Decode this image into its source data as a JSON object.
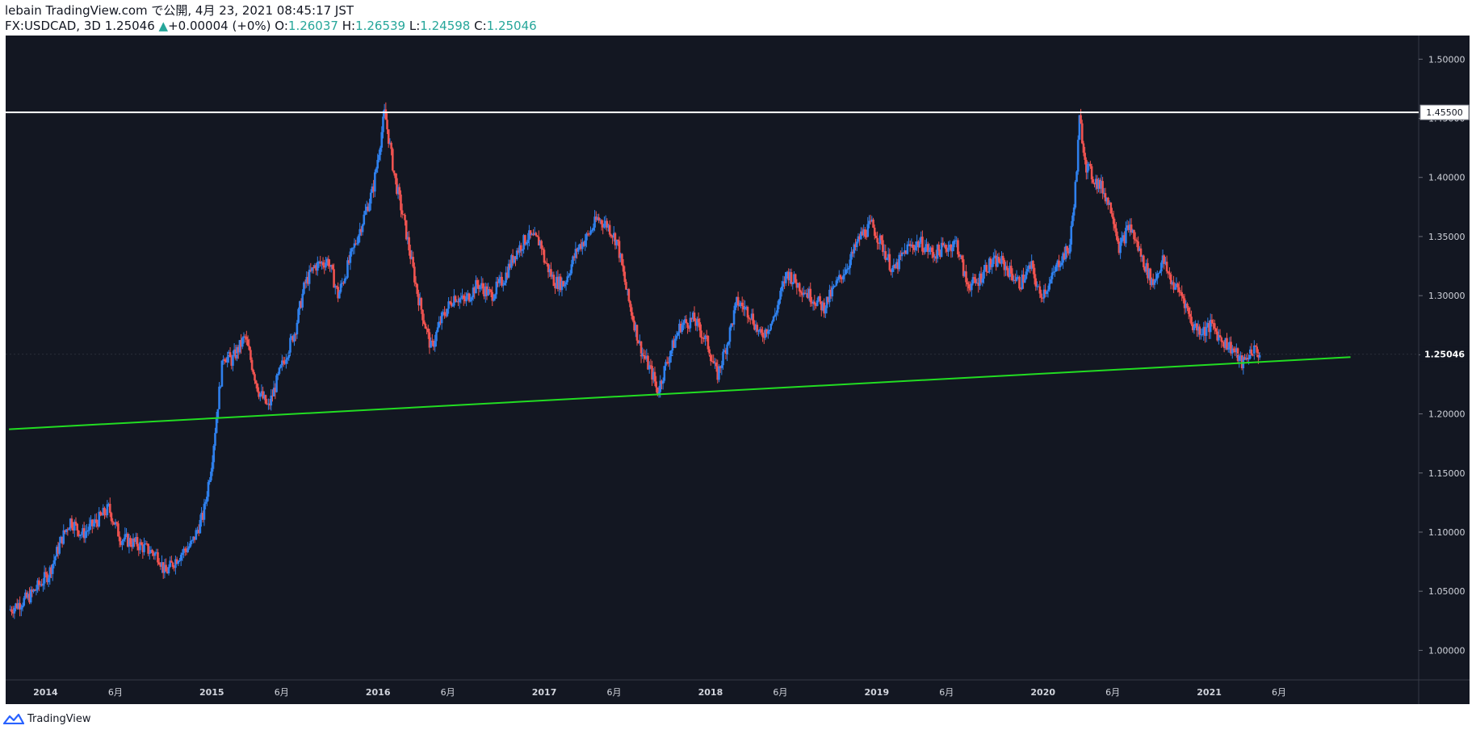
{
  "header": {
    "published_line": "lebain TradingView.com で公開, 4月 23, 2021 08:45:17 JST",
    "symbol": "FX:USDCAD, 3D",
    "last": "1.25046",
    "change": "+0.00004 (+0%)",
    "ohlc": [
      {
        "label": "O:",
        "value": "1.26037"
      },
      {
        "label": "H:",
        "value": "1.26539"
      },
      {
        "label": "L:",
        "value": "1.24598"
      },
      {
        "label": "C:",
        "value": "1.25046"
      }
    ]
  },
  "footer": {
    "brand": "TradingView"
  },
  "colors": {
    "background": "#131722",
    "up": "#2f80ed",
    "down": "#ef5350",
    "support_line": "#22dd22",
    "resistance_line": "#ffffff",
    "axis_text": "#d1d4dc"
  },
  "chart_data": {
    "type": "candlestick",
    "symbol": "FX:USDCAD",
    "interval": "3D",
    "ylim": [
      0.975,
      1.52
    ],
    "y_ticks": [
      "1.00000",
      "1.05000",
      "1.10000",
      "1.15000",
      "1.20000",
      "1.25000",
      "1.30000",
      "1.35000",
      "1.40000",
      "1.45000",
      "1.50000"
    ],
    "x_ticks": [
      {
        "t": 2014.0,
        "label": "2014"
      },
      {
        "t": 2014.42,
        "label": "6月"
      },
      {
        "t": 2015.0,
        "label": "2015"
      },
      {
        "t": 2015.42,
        "label": "6月"
      },
      {
        "t": 2016.0,
        "label": "2016"
      },
      {
        "t": 2016.42,
        "label": "6月"
      },
      {
        "t": 2017.0,
        "label": "2017"
      },
      {
        "t": 2017.42,
        "label": "6月"
      },
      {
        "t": 2018.0,
        "label": "2018"
      },
      {
        "t": 2018.42,
        "label": "6月"
      },
      {
        "t": 2019.0,
        "label": "2019"
      },
      {
        "t": 2019.42,
        "label": "6月"
      },
      {
        "t": 2020.0,
        "label": "2020"
      },
      {
        "t": 2020.42,
        "label": "6月"
      },
      {
        "t": 2021.0,
        "label": "2021"
      },
      {
        "t": 2021.42,
        "label": "6月"
      }
    ],
    "price_path": [
      [
        2013.78,
        1.034
      ],
      [
        2013.9,
        1.045
      ],
      [
        2014.02,
        1.065
      ],
      [
        2014.1,
        1.095
      ],
      [
        2014.15,
        1.11
      ],
      [
        2014.22,
        1.098
      ],
      [
        2014.3,
        1.108
      ],
      [
        2014.38,
        1.12
      ],
      [
        2014.45,
        1.095
      ],
      [
        2014.55,
        1.09
      ],
      [
        2014.68,
        1.08
      ],
      [
        2014.72,
        1.065
      ],
      [
        2014.8,
        1.08
      ],
      [
        2014.88,
        1.09
      ],
      [
        2014.95,
        1.115
      ],
      [
        2015.0,
        1.16
      ],
      [
        2015.03,
        1.2
      ],
      [
        2015.07,
        1.25
      ],
      [
        2015.12,
        1.245
      ],
      [
        2015.2,
        1.265
      ],
      [
        2015.28,
        1.22
      ],
      [
        2015.34,
        1.205
      ],
      [
        2015.42,
        1.24
      ],
      [
        2015.5,
        1.27
      ],
      [
        2015.56,
        1.31
      ],
      [
        2015.62,
        1.325
      ],
      [
        2015.7,
        1.33
      ],
      [
        2015.76,
        1.3
      ],
      [
        2015.83,
        1.33
      ],
      [
        2015.9,
        1.36
      ],
      [
        2015.97,
        1.39
      ],
      [
        2016.04,
        1.455
      ],
      [
        2016.1,
        1.4
      ],
      [
        2016.16,
        1.36
      ],
      [
        2016.24,
        1.3
      ],
      [
        2016.32,
        1.255
      ],
      [
        2016.38,
        1.28
      ],
      [
        2016.46,
        1.3
      ],
      [
        2016.52,
        1.295
      ],
      [
        2016.6,
        1.31
      ],
      [
        2016.68,
        1.3
      ],
      [
        2016.76,
        1.315
      ],
      [
        2016.82,
        1.335
      ],
      [
        2016.9,
        1.35
      ],
      [
        2016.98,
        1.345
      ],
      [
        2017.0,
        1.33
      ],
      [
        2017.06,
        1.312
      ],
      [
        2017.12,
        1.31
      ],
      [
        2017.2,
        1.34
      ],
      [
        2017.26,
        1.35
      ],
      [
        2017.32,
        1.365
      ],
      [
        2017.38,
        1.36
      ],
      [
        2017.44,
        1.345
      ],
      [
        2017.5,
        1.3
      ],
      [
        2017.58,
        1.255
      ],
      [
        2017.66,
        1.23
      ],
      [
        2017.68,
        1.218
      ],
      [
        2017.74,
        1.245
      ],
      [
        2017.82,
        1.275
      ],
      [
        2017.9,
        1.28
      ],
      [
        2017.98,
        1.26
      ],
      [
        2018.04,
        1.232
      ],
      [
        2018.1,
        1.26
      ],
      [
        2018.16,
        1.295
      ],
      [
        2018.24,
        1.285
      ],
      [
        2018.3,
        1.265
      ],
      [
        2018.38,
        1.28
      ],
      [
        2018.46,
        1.32
      ],
      [
        2018.52,
        1.31
      ],
      [
        2018.6,
        1.3
      ],
      [
        2018.68,
        1.29
      ],
      [
        2018.76,
        1.31
      ],
      [
        2018.84,
        1.33
      ],
      [
        2018.9,
        1.35
      ],
      [
        2018.97,
        1.36
      ],
      [
        2019.04,
        1.34
      ],
      [
        2019.1,
        1.32
      ],
      [
        2019.18,
        1.34
      ],
      [
        2019.26,
        1.345
      ],
      [
        2019.34,
        1.335
      ],
      [
        2019.4,
        1.34
      ],
      [
        2019.48,
        1.345
      ],
      [
        2019.54,
        1.31
      ],
      [
        2019.6,
        1.31
      ],
      [
        2019.66,
        1.325
      ],
      [
        2019.74,
        1.33
      ],
      [
        2019.8,
        1.32
      ],
      [
        2019.86,
        1.31
      ],
      [
        2019.93,
        1.325
      ],
      [
        2019.98,
        1.3
      ],
      [
        2020.04,
        1.31
      ],
      [
        2020.1,
        1.33
      ],
      [
        2020.16,
        1.34
      ],
      [
        2020.2,
        1.4
      ],
      [
        2020.22,
        1.45
      ],
      [
        2020.26,
        1.41
      ],
      [
        2020.3,
        1.4
      ],
      [
        2020.36,
        1.39
      ],
      [
        2020.42,
        1.37
      ],
      [
        2020.46,
        1.34
      ],
      [
        2020.52,
        1.36
      ],
      [
        2020.6,
        1.33
      ],
      [
        2020.66,
        1.31
      ],
      [
        2020.72,
        1.33
      ],
      [
        2020.78,
        1.31
      ],
      [
        2020.84,
        1.3
      ],
      [
        2020.9,
        1.275
      ],
      [
        2020.96,
        1.27
      ],
      [
        2021.02,
        1.275
      ],
      [
        2021.06,
        1.265
      ],
      [
        2021.14,
        1.255
      ],
      [
        2021.2,
        1.242
      ],
      [
        2021.26,
        1.255
      ],
      [
        2021.31,
        1.2505
      ]
    ],
    "horizontal_line": {
      "value": 1.455,
      "label": "1.45500"
    },
    "trend_line": {
      "from": [
        2013.78,
        1.187
      ],
      "to": [
        2021.85,
        1.248
      ]
    },
    "last_price": {
      "value": 1.25046,
      "label": "1.25046"
    }
  }
}
